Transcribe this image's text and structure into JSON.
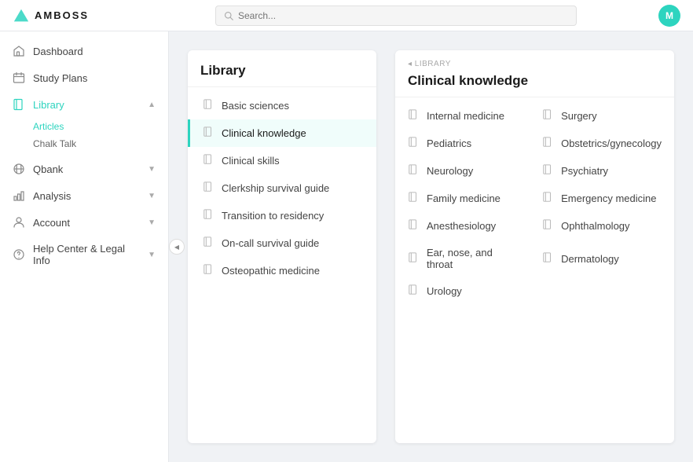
{
  "app": {
    "name": "AMBOSS"
  },
  "topbar": {
    "search_placeholder": "Search...",
    "avatar_label": "M"
  },
  "sidebar": {
    "items": [
      {
        "id": "dashboard",
        "label": "Dashboard",
        "icon": "home"
      },
      {
        "id": "study-plans",
        "label": "Study Plans",
        "icon": "calendar"
      },
      {
        "id": "library",
        "label": "Library",
        "icon": "book",
        "active": true,
        "expanded": true,
        "subitems": [
          {
            "id": "articles",
            "label": "Articles",
            "active": true
          },
          {
            "id": "chalk-talk",
            "label": "Chalk Talk"
          }
        ]
      },
      {
        "id": "qbank",
        "label": "Qbank",
        "icon": "grid"
      },
      {
        "id": "analysis",
        "label": "Analysis",
        "icon": "bar-chart"
      },
      {
        "id": "account",
        "label": "Account",
        "icon": "user"
      },
      {
        "id": "help",
        "label": "Help Center & Legal Info",
        "icon": "help-circle"
      }
    ]
  },
  "library_panel": {
    "title": "Library",
    "items": [
      {
        "id": "basic-sciences",
        "label": "Basic sciences"
      },
      {
        "id": "clinical-knowledge",
        "label": "Clinical knowledge",
        "selected": true
      },
      {
        "id": "clinical-skills",
        "label": "Clinical skills"
      },
      {
        "id": "clerkship-survival-guide",
        "label": "Clerkship survival guide"
      },
      {
        "id": "transition-to-residency",
        "label": "Transition to residency"
      },
      {
        "id": "on-call-survival-guide",
        "label": "On-call survival guide"
      },
      {
        "id": "osteopathic-medicine",
        "label": "Osteopathic medicine"
      }
    ]
  },
  "ck_panel": {
    "breadcrumb": "◂ LIBRARY",
    "title": "Clinical knowledge",
    "items": [
      {
        "id": "internal-medicine",
        "label": "Internal medicine"
      },
      {
        "id": "surgery",
        "label": "Surgery"
      },
      {
        "id": "pediatrics",
        "label": "Pediatrics"
      },
      {
        "id": "ob-gyn",
        "label": "Obstetrics/gynecology"
      },
      {
        "id": "neurology",
        "label": "Neurology"
      },
      {
        "id": "psychiatry",
        "label": "Psychiatry"
      },
      {
        "id": "family-medicine",
        "label": "Family medicine"
      },
      {
        "id": "emergency-medicine",
        "label": "Emergency medicine"
      },
      {
        "id": "anesthesiology",
        "label": "Anesthesiology"
      },
      {
        "id": "ophthalmology",
        "label": "Ophthalmology"
      },
      {
        "id": "ear-nose-throat",
        "label": "Ear, nose, and throat"
      },
      {
        "id": "dermatology",
        "label": "Dermatology"
      },
      {
        "id": "urology",
        "label": "Urology"
      }
    ]
  }
}
